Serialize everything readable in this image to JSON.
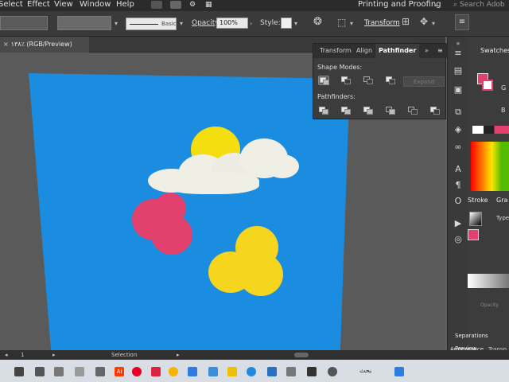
{
  "menu": {
    "items": [
      "Select",
      "Effect",
      "View",
      "Window",
      "Help"
    ],
    "workspace": "Printing and Proofing",
    "search_placeholder": "Search Adob"
  },
  "control_bar": {
    "stroke_style": "Basic",
    "opacity_label": "Opacity:",
    "opacity_value": "100%",
    "style_label": "Style:",
    "transform_label": "Transform"
  },
  "document": {
    "tab_title": "۱۳۸٪ (RGB/Preview)"
  },
  "pathfinder_panel": {
    "tabs": [
      "Transform",
      "Align",
      "Pathfinder"
    ],
    "active_tab": "Pathfinder",
    "shape_modes_label": "Shape Modes:",
    "pathfinders_label": "Pathfinders:",
    "expand_label": "Expand"
  },
  "right_panels": {
    "swatches": "Swatches",
    "stroke": "Stroke",
    "gradient_short": "Gra",
    "type_label": "Type:",
    "opacity_label": "Opacity",
    "separations": "Separations Preview",
    "appearance": "Appearance",
    "transparency_short": "Transp",
    "g_letter": "G",
    "b_letter": "B"
  },
  "artwork": {
    "artboard_color": "#1a8de0",
    "sun_color": "#f4de10",
    "cloud_color": "#efefe6",
    "pink_color": "#e2416e",
    "yellow_cluster_color": "#f5d51e"
  },
  "status": {
    "zoom": "1",
    "tool": "Selection"
  },
  "taskbar": {
    "search_text": "بحث"
  }
}
